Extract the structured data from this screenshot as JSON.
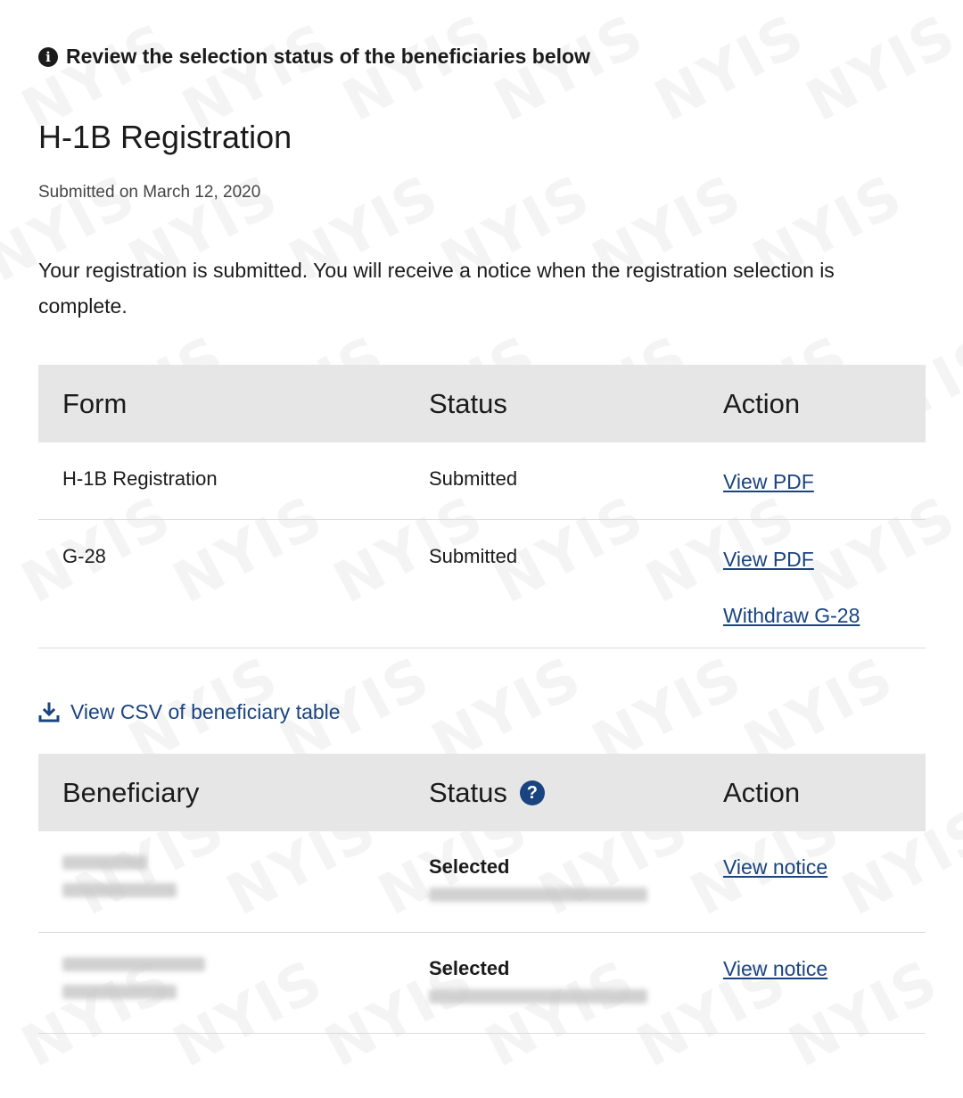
{
  "notice": {
    "icon": "info-icon",
    "text": "Review the selection status of the beneficiaries below"
  },
  "page_title": "H-1B Registration",
  "submitted_on": "Submitted on March 12, 2020",
  "intro": "Your registration is submitted. You will receive a notice when the registration selection is complete.",
  "watermark": "NYIS",
  "forms_table": {
    "headers": [
      "Form",
      "Status",
      "Action"
    ],
    "rows": [
      {
        "form": "H-1B Registration",
        "status": "Submitted",
        "actions": [
          "View PDF"
        ]
      },
      {
        "form": "G-28",
        "status": "Submitted",
        "actions": [
          "View PDF",
          "Withdraw G-28"
        ]
      }
    ]
  },
  "csv_link": {
    "icon": "download-icon",
    "label": "View CSV of beneficiary table"
  },
  "beneficiary_table": {
    "headers": [
      "Beneficiary",
      "Status",
      "Action"
    ],
    "status_help_icon": "question-circle-icon",
    "rows": [
      {
        "status": "Selected",
        "action": "View notice"
      },
      {
        "status": "Selected",
        "action": "View notice"
      }
    ]
  },
  "colors": {
    "link": "#1a4480",
    "header_bg": "#e6e6e6",
    "text": "#1b1b1b"
  }
}
